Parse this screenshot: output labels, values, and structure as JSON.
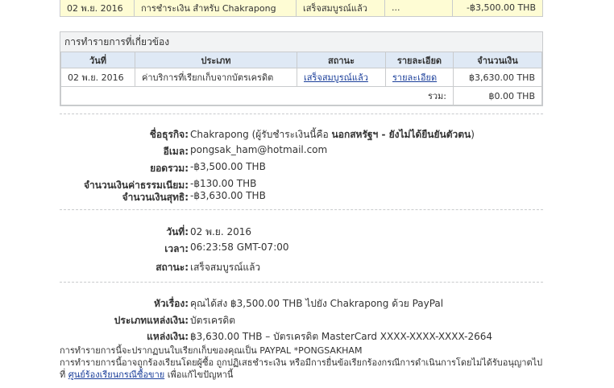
{
  "top_row": {
    "date": "02 พ.ย. 2016",
    "type": "การชำระเงิน สำหรับ Chakrapong",
    "status": "เสร็จสมบูรณ์แล้ว",
    "detail": "...",
    "amount": "-฿3,500.00 THB"
  },
  "related": {
    "title": "การทำรายการที่เกี่ยวข้อง",
    "headers": [
      "วันที่",
      "ประเภท",
      "สถานะ",
      "รายละเอียด",
      "จำนวนเงิน"
    ],
    "rows": [
      {
        "date": "02 พ.ย. 2016",
        "type": "ค่าบริการที่เรียกเก็บจากบัตรเครดิต",
        "status": "เสร็จสมบูรณ์แล้ว",
        "detail": "รายละเอียด",
        "amount": "฿3,630.00 THB"
      }
    ],
    "total_label": "รวม:",
    "total_value": "฿0.00 THB"
  },
  "business": {
    "name_label": "ชื่อธุรกิจ:",
    "name_value": "Chakrapong (ผู้รับชำระเงินนี้คือ ",
    "name_bold": "นอกสหรัฐฯ - ยังไม่ได้ยืนยันตัวตน",
    "name_close": ")",
    "email_label": "อีเมล:",
    "email_value": "pongsak_ham@hotmail.com",
    "total_label": "ยอดรวม:",
    "total_value": "-฿3,500.00 THB",
    "fee_label": "จำนวนเงินค่าธรรมเนียม:",
    "fee_value": "-฿130.00 THB",
    "net_label": "จำนวนเงินสุทธิ:",
    "net_value": "-฿3,630.00 THB"
  },
  "timing": {
    "date_label": "วันที่:",
    "date_value": "02 พ.ย. 2016",
    "time_label": "เวลา:",
    "time_value": "06:23:58 GMT-07:00",
    "status_label": "สถานะ:",
    "status_value": "เสร็จสมบูรณ์แล้ว"
  },
  "payment": {
    "subject_label": "หัวเรื่อง:",
    "subject_value": "คุณได้ส่ง ฿3,500.00 THB ไปยัง Chakrapong ด้วย PayPal",
    "source_type_label": "ประเภทแหล่งเงิน:",
    "source_type_value": "บัตรเครดิต",
    "source_label": "แหล่งเงิน:",
    "source_value": "฿3,630.00 THB – บัตรเครดิต MasterCard XXXX-XXXX-XXXX-2664"
  },
  "notes": {
    "line1": "การทำรายการนี้จะปรากฏบนใบเรียกเก็บของคุณเป็น PAYPAL *PONGSAKHAM",
    "line2": "การทำรายการนี้อาจถูกร้องเรียนโดยผู้ซื้อ ถูกปฏิเสธชำระเงิน หรือมีการยื่นข้อเรียกร้องกรณีการดำเนินการโดยไม่ได้รับอนุญาตไป",
    "line3_prefix": "ที่ ",
    "line3_link": "ศูนย์ร้องเรียนกรณีซื้อขาย",
    "line3_suffix": " เพื่อแก้ไขปัญหานี้"
  }
}
